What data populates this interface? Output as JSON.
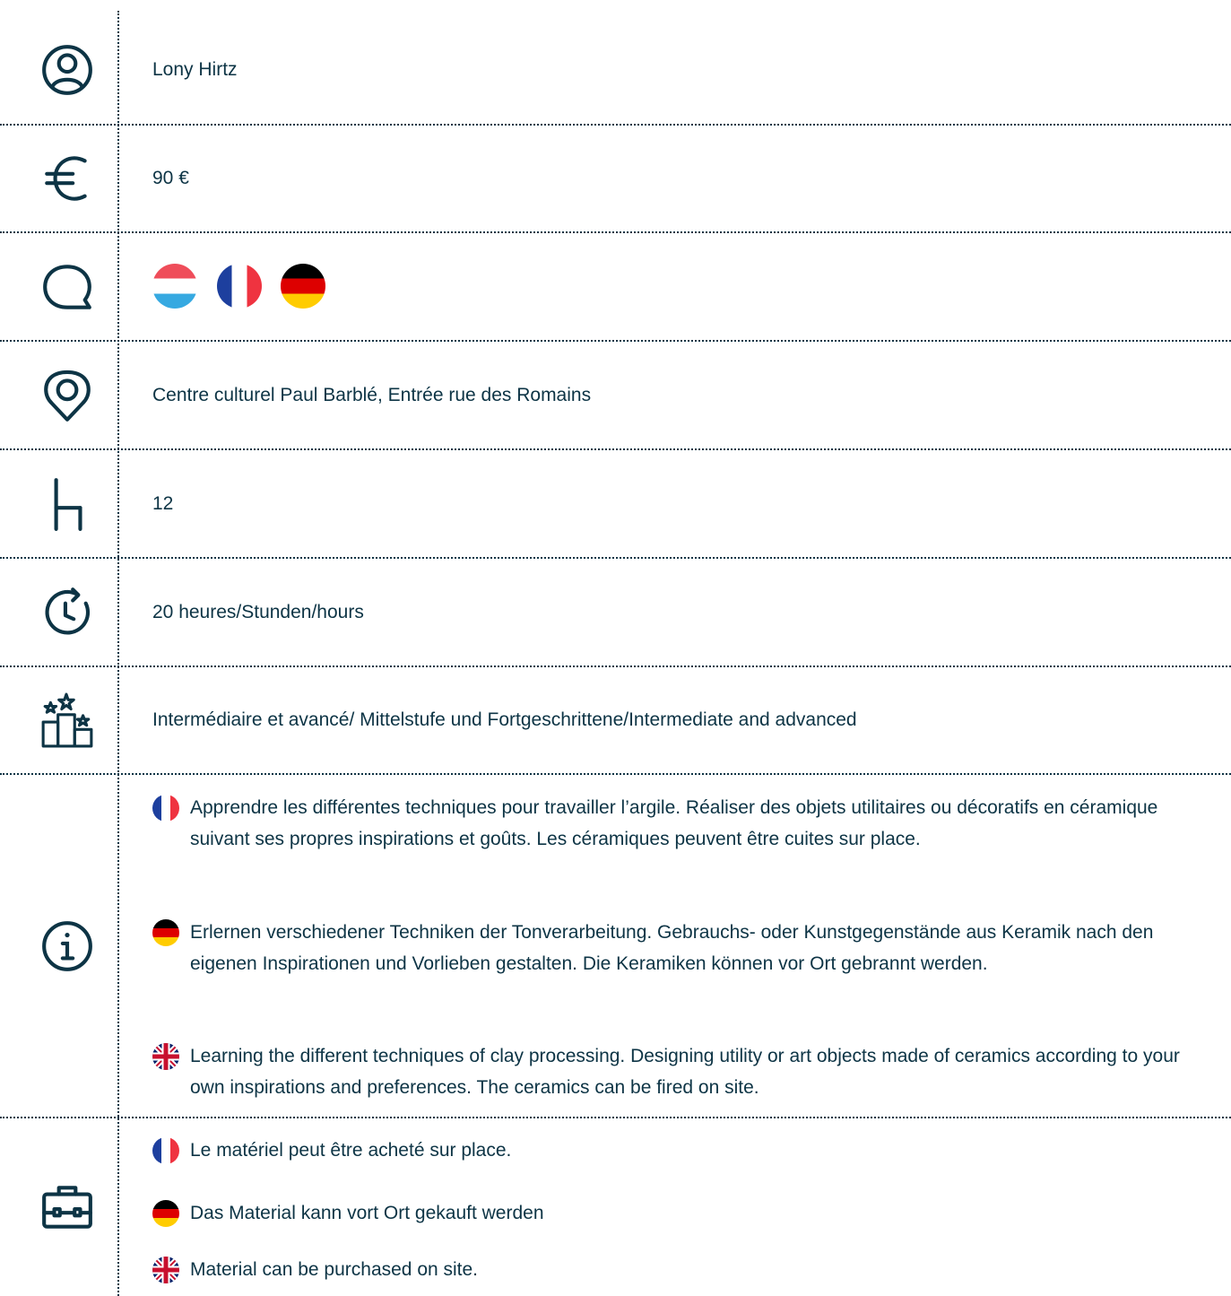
{
  "instructor": {
    "name": "Lony Hirtz"
  },
  "price": {
    "value": "90 €"
  },
  "languages": [
    {
      "code": "lu",
      "icon": "flag-luxembourg-icon"
    },
    {
      "code": "fr",
      "icon": "flag-france-icon"
    },
    {
      "code": "de",
      "icon": "flag-germany-icon"
    }
  ],
  "location": {
    "value": "Centre culturel Paul Barblé, Entrée rue des Romains"
  },
  "seats": {
    "value": "12"
  },
  "duration": {
    "value": "20 heures/Stunden/hours"
  },
  "level": {
    "value": "Intermédiaire et avancé/ Mittelstufe und Fortgeschrittene/Intermediate and advanced"
  },
  "description": {
    "fr": "Apprendre les différentes techniques pour travailler l’argile. Réaliser des objets utilitaires ou décoratifs en céramique suivant ses propres inspirations et goûts. Les céramiques peuvent être cuites sur place.",
    "de": "Erlernen verschiedener Techniken der Tonverarbeitung. Gebrauchs- oder Kunstgegenstände aus Keramik nach den eigenen Inspirationen und Vorlieben gestalten. Die Keramiken können vor Ort gebrannt werden.",
    "en": "Learning the different techniques of clay processing. Designing utility or art objects made of ceramics according to your own inspirations and preferences. The ceramics can be fired on site."
  },
  "material": {
    "fr": "Le matériel peut être acheté sur place.",
    "de": "Das Material kann vort Ort gekauft werden",
    "en": "Material can be purchased on site."
  },
  "colors": {
    "primary": "#0d3445"
  },
  "icons": [
    "user-icon",
    "euro-icon",
    "speech-bubble-icon",
    "location-pin-icon",
    "chair-icon",
    "clock-icon",
    "podium-icon",
    "info-icon",
    "briefcase-icon"
  ]
}
